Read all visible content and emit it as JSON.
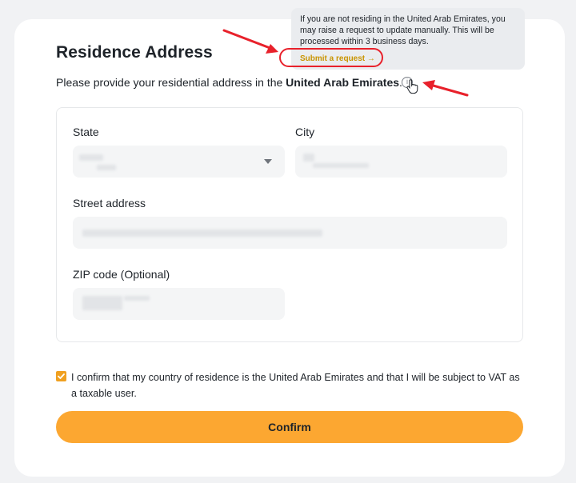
{
  "page": {
    "title": "Residence Address",
    "subtitle_prefix": "Please provide your residential address in the ",
    "subtitle_country": "United Arab Emirates",
    "subtitle_suffix": "."
  },
  "tooltip": {
    "text": "If you are not residing in the United Arab Emirates, you may raise a request to update manually. This will be processed within 3 business days.",
    "link_label": "Submit a request →"
  },
  "form": {
    "state_label": "State",
    "city_label": "City",
    "street_label": "Street address",
    "zip_label": "ZIP code (Optional)"
  },
  "consent": {
    "checked": true,
    "text": "I confirm that my country of residence is the United Arab Emirates and that I will be subject to VAT as a taxable user."
  },
  "actions": {
    "confirm_label": "Confirm"
  },
  "colors": {
    "accent": "#fca731",
    "link": "#c99400",
    "highlight": "#e8212b"
  }
}
